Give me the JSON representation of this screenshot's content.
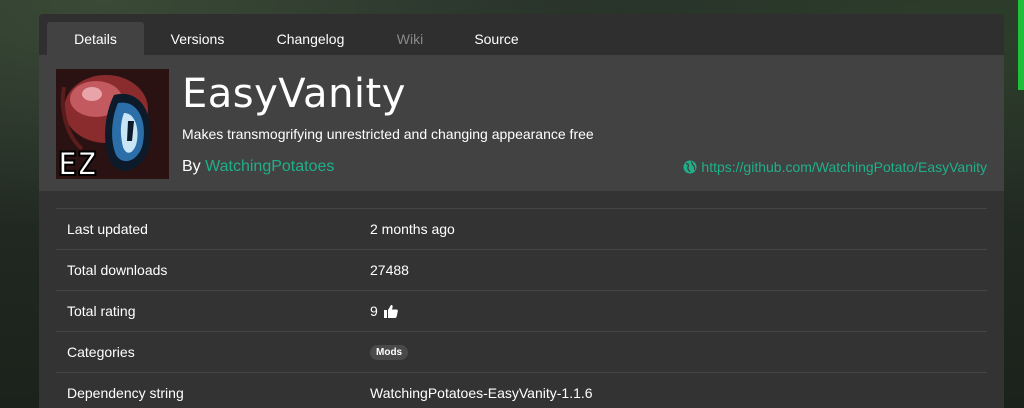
{
  "tabs": [
    {
      "label": "Details",
      "active": true
    },
    {
      "label": "Versions"
    },
    {
      "label": "Changelog"
    },
    {
      "label": "Wiki",
      "disabled": true
    },
    {
      "label": "Source"
    }
  ],
  "header": {
    "title": "EasyVanity",
    "description": "Makes transmogrifying unrestricted and changing appearance free",
    "by_label": "By",
    "author": "WatchingPotatoes",
    "website": "https://github.com/WatchingPotato/EasyVanity",
    "icon_text": "EZ",
    "accent_color": "#1fb08a"
  },
  "details": {
    "last_updated": {
      "label": "Last updated",
      "value": "2 months ago"
    },
    "total_downloads": {
      "label": "Total downloads",
      "value": "27488"
    },
    "total_rating": {
      "label": "Total rating",
      "value": "9"
    },
    "categories": {
      "label": "Categories",
      "badge": "Mods"
    },
    "dependency_string": {
      "label": "Dependency string",
      "value": "WatchingPotatoes-EasyVanity-1.1.6"
    }
  }
}
